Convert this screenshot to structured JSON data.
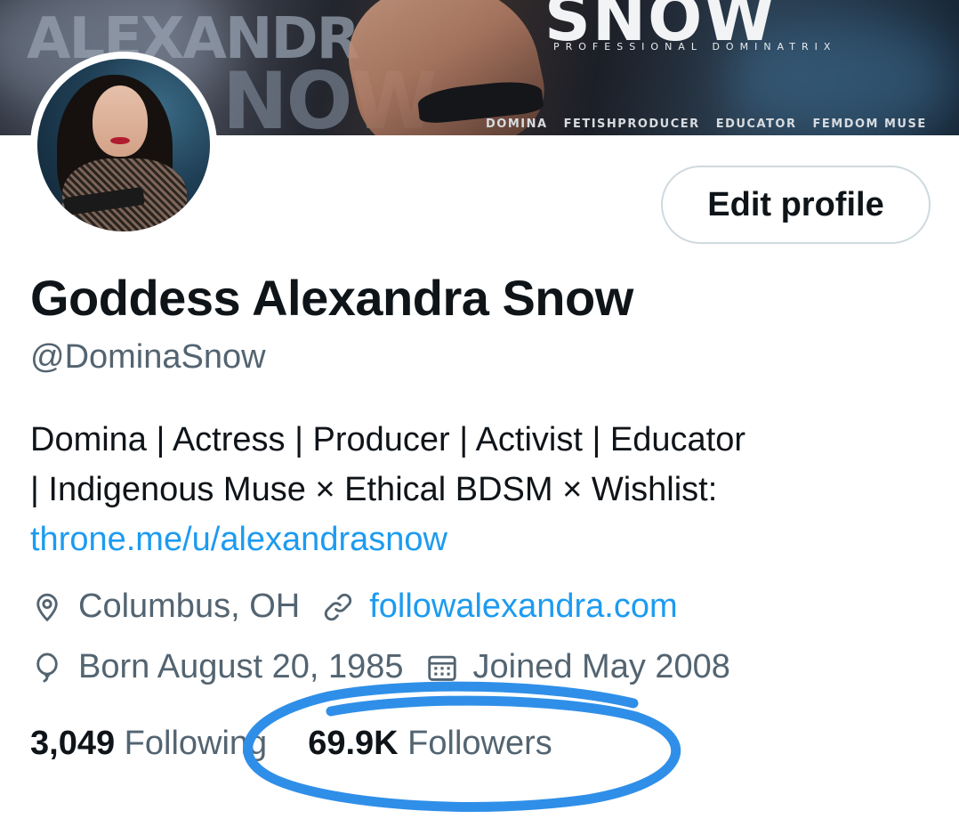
{
  "banner": {
    "name_fragment_1": "ALEXANDR",
    "name_fragment_2": "NOW",
    "brand": "SNOW",
    "subtitle": "PROFESSIONAL DOMINATRIX",
    "tags": [
      "DOMINA",
      "FETISHPRODUCER",
      "EDUCATOR",
      "FEMDOM MUSE"
    ]
  },
  "profile": {
    "edit_label": "Edit profile",
    "display_name": "Goddess Alexandra Snow",
    "handle": "@DominaSnow",
    "bio_line_1": "Domina | Actress | Producer | Activist | Educator",
    "bio_line_2": "| Indigenous Muse × Ethical BDSM × Wishlist:",
    "bio_link": "throne.me/u/alexandrasnow",
    "location": "Columbus, OH",
    "website": "followalexandra.com",
    "birthday": "Born August 20, 1985",
    "joined": "Joined May 2008"
  },
  "stats": {
    "following_count": "3,049",
    "following_label": "Following",
    "followers_count": "69.9K",
    "followers_label": "Followers"
  },
  "colors": {
    "link": "#1d9bf0",
    "secondary_text": "#536471",
    "primary_text": "#0f1419",
    "marker": "#2f8fe8"
  }
}
